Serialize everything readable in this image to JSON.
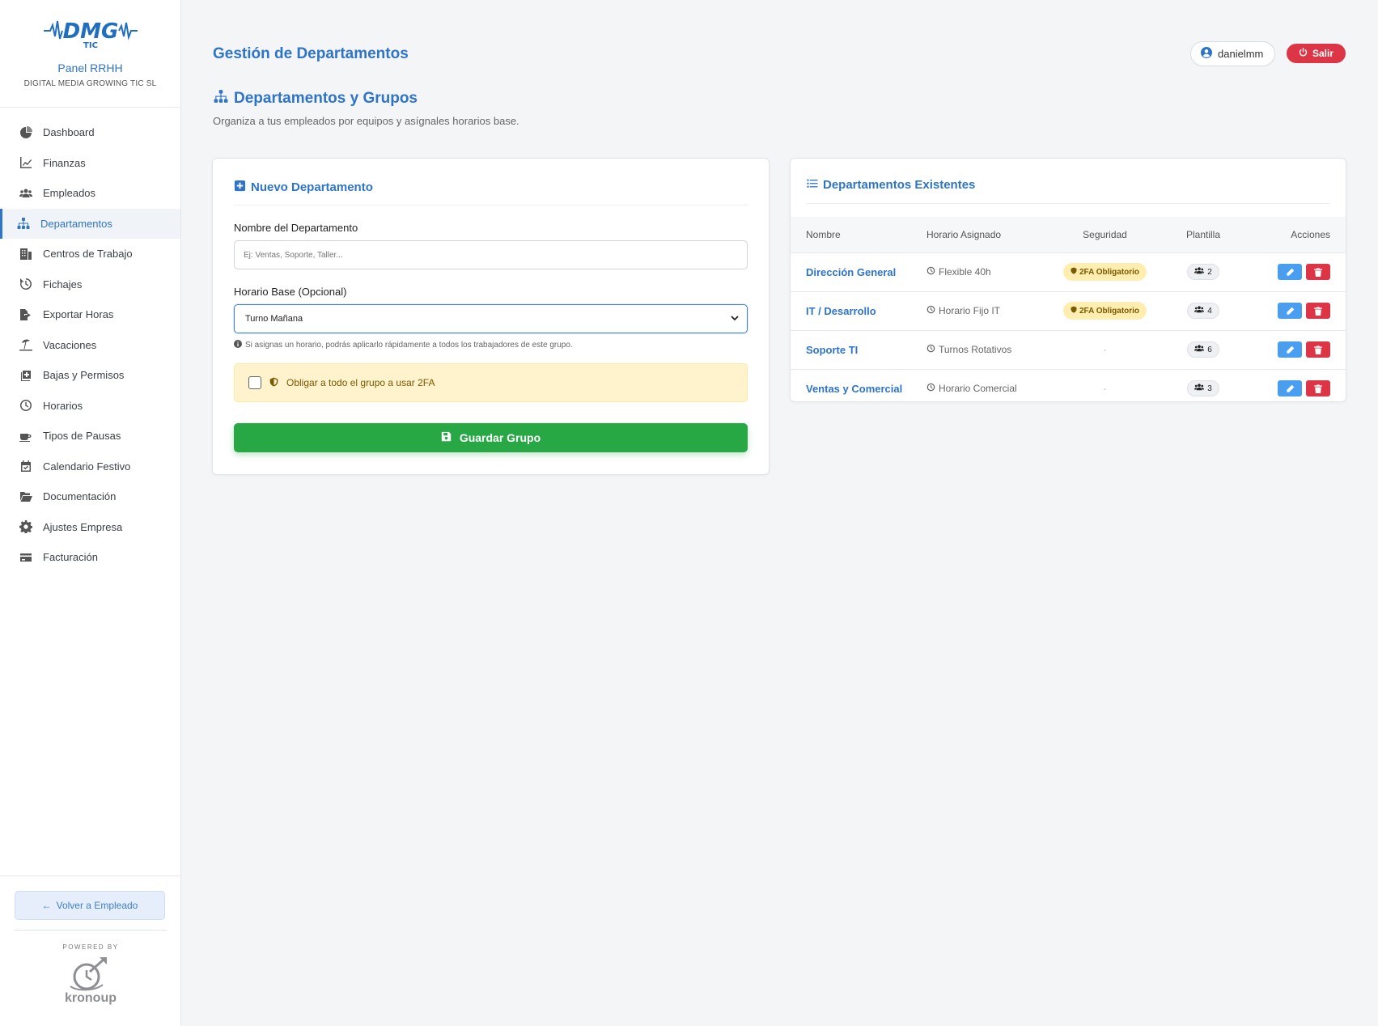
{
  "brand": {
    "logo_text": "DMG",
    "logo_sub": "TIC",
    "title": "Panel RRHH",
    "company": "DIGITAL MEDIA GROWING TIC SL"
  },
  "sidebar": {
    "items": [
      {
        "label": "Dashboard",
        "icon": "pie-chart-icon"
      },
      {
        "label": "Finanzas",
        "icon": "line-chart-icon"
      },
      {
        "label": "Empleados",
        "icon": "users-icon"
      },
      {
        "label": "Departamentos",
        "icon": "sitemap-icon",
        "active": true
      },
      {
        "label": "Centros de Trabajo",
        "icon": "building-icon"
      },
      {
        "label": "Fichajes",
        "icon": "history-icon"
      },
      {
        "label": "Exportar Horas",
        "icon": "file-export-icon"
      },
      {
        "label": "Vacaciones",
        "icon": "umbrella-beach-icon"
      },
      {
        "label": "Bajas y Permisos",
        "icon": "notes-medical-icon"
      },
      {
        "label": "Horarios",
        "icon": "clock-icon"
      },
      {
        "label": "Tipos de Pausas",
        "icon": "coffee-icon"
      },
      {
        "label": "Calendario Festivo",
        "icon": "calendar-check-icon"
      },
      {
        "label": "Documentación",
        "icon": "folder-open-icon"
      },
      {
        "label": "Ajustes Empresa",
        "icon": "gear-icon"
      },
      {
        "label": "Facturación",
        "icon": "credit-card-icon"
      }
    ],
    "back_label": "Volver a Empleado",
    "powered_by": "POWERED BY",
    "powered_brand": "kronoup"
  },
  "header": {
    "page_title": "Gestión de Departamentos",
    "username": "danielmm",
    "logout_label": "Salir"
  },
  "section": {
    "title": "Departamentos y Grupos",
    "subtitle": "Organiza a tus empleados por equipos y asígnales horarios base."
  },
  "form": {
    "title": "Nuevo Departamento",
    "name_label": "Nombre del Departamento",
    "name_placeholder": "Ej: Ventas, Soporte, Taller...",
    "schedule_label": "Horario Base (Opcional)",
    "schedule_value": "Turno Mañana",
    "hint": "Si asignas un horario, podrás aplicarlo rápidamente a todos los trabajadores de este grupo.",
    "twofa_label": "Obligar a todo el grupo a usar 2FA",
    "twofa_checked": false,
    "save_label": "Guardar Grupo"
  },
  "list": {
    "title": "Departamentos Existentes",
    "columns": [
      "Nombre",
      "Horario Asignado",
      "Seguridad",
      "Plantilla",
      "Acciones"
    ],
    "rows": [
      {
        "name": "Dirección General",
        "schedule": "Flexible 40h",
        "security": "2FA Obligatorio",
        "staff": "2"
      },
      {
        "name": "IT / Desarrollo",
        "schedule": "Horario Fijo IT",
        "security": "2FA Obligatorio",
        "staff": "4"
      },
      {
        "name": "Soporte TI",
        "schedule": "Turnos Rotativos",
        "security": "-",
        "staff": "6"
      },
      {
        "name": "Ventas y Comercial",
        "schedule": "Horario Comercial",
        "security": "-",
        "staff": "3"
      }
    ]
  },
  "colors": {
    "primary": "#2e74c9",
    "success": "#28a745",
    "danger": "#dc3545",
    "edit": "#4a9ef0",
    "warning_bg": "#fff3cd"
  }
}
